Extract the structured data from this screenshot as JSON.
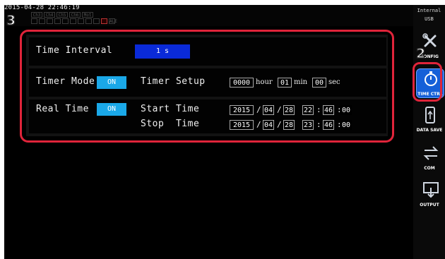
{
  "status": {
    "datetime": "2015-04-28 22:46:19",
    "channels_row1": [
      "Ch3",
      "Ch4",
      "Ch5",
      "Ch6",
      "Mot"
    ],
    "channels_row2": [
      "",
      "",
      "",
      "",
      "",
      "",
      "",
      "",
      "",
      "",
      "",
      "",
      "ALE"
    ]
  },
  "sidebar": {
    "storage_line1": "Internal",
    "storage_line2": "USB",
    "buttons": [
      {
        "label": "CONFIG",
        "icon": "wrench-screwdriver-icon"
      },
      {
        "label": "TIME CTRL",
        "icon": "stopwatch-icon"
      },
      {
        "label": "DATA SAVE",
        "icon": "usb-drive-icon"
      },
      {
        "label": "COM",
        "icon": "double-arrow-icon"
      },
      {
        "label": "OUTPUT",
        "icon": "output-monitor-icon"
      }
    ]
  },
  "panel": {
    "time_interval_label": "Time Interval",
    "time_interval_value": "1 s",
    "timer_mode_label": "Timer Mode",
    "timer_mode_state": "ON",
    "timer_setup_label": "Timer Setup",
    "timer_hour": "0000",
    "hour_unit": "hour",
    "timer_min": "01",
    "min_unit": "min",
    "timer_sec": "00",
    "sec_unit": "sec",
    "real_time_label": "Real Time",
    "real_time_state": "ON",
    "start_time_label": "Start Time",
    "stop_time_label": "Stop  Time",
    "start": {
      "year": "2015",
      "month": "04",
      "day": "28",
      "hour": "22",
      "min": "46",
      "sec": "00"
    },
    "stop": {
      "year": "2015",
      "month": "04",
      "day": "28",
      "hour": "23",
      "min": "46",
      "sec": "00"
    },
    "slash": "/",
    "colon": ":"
  },
  "markers": {
    "step2": "2",
    "step3": "3"
  },
  "colors": {
    "accent": "#1aa8e8",
    "value_box": "#0a2ad8",
    "highlight": "#e0243a",
    "selected_button": "#1560d8"
  }
}
